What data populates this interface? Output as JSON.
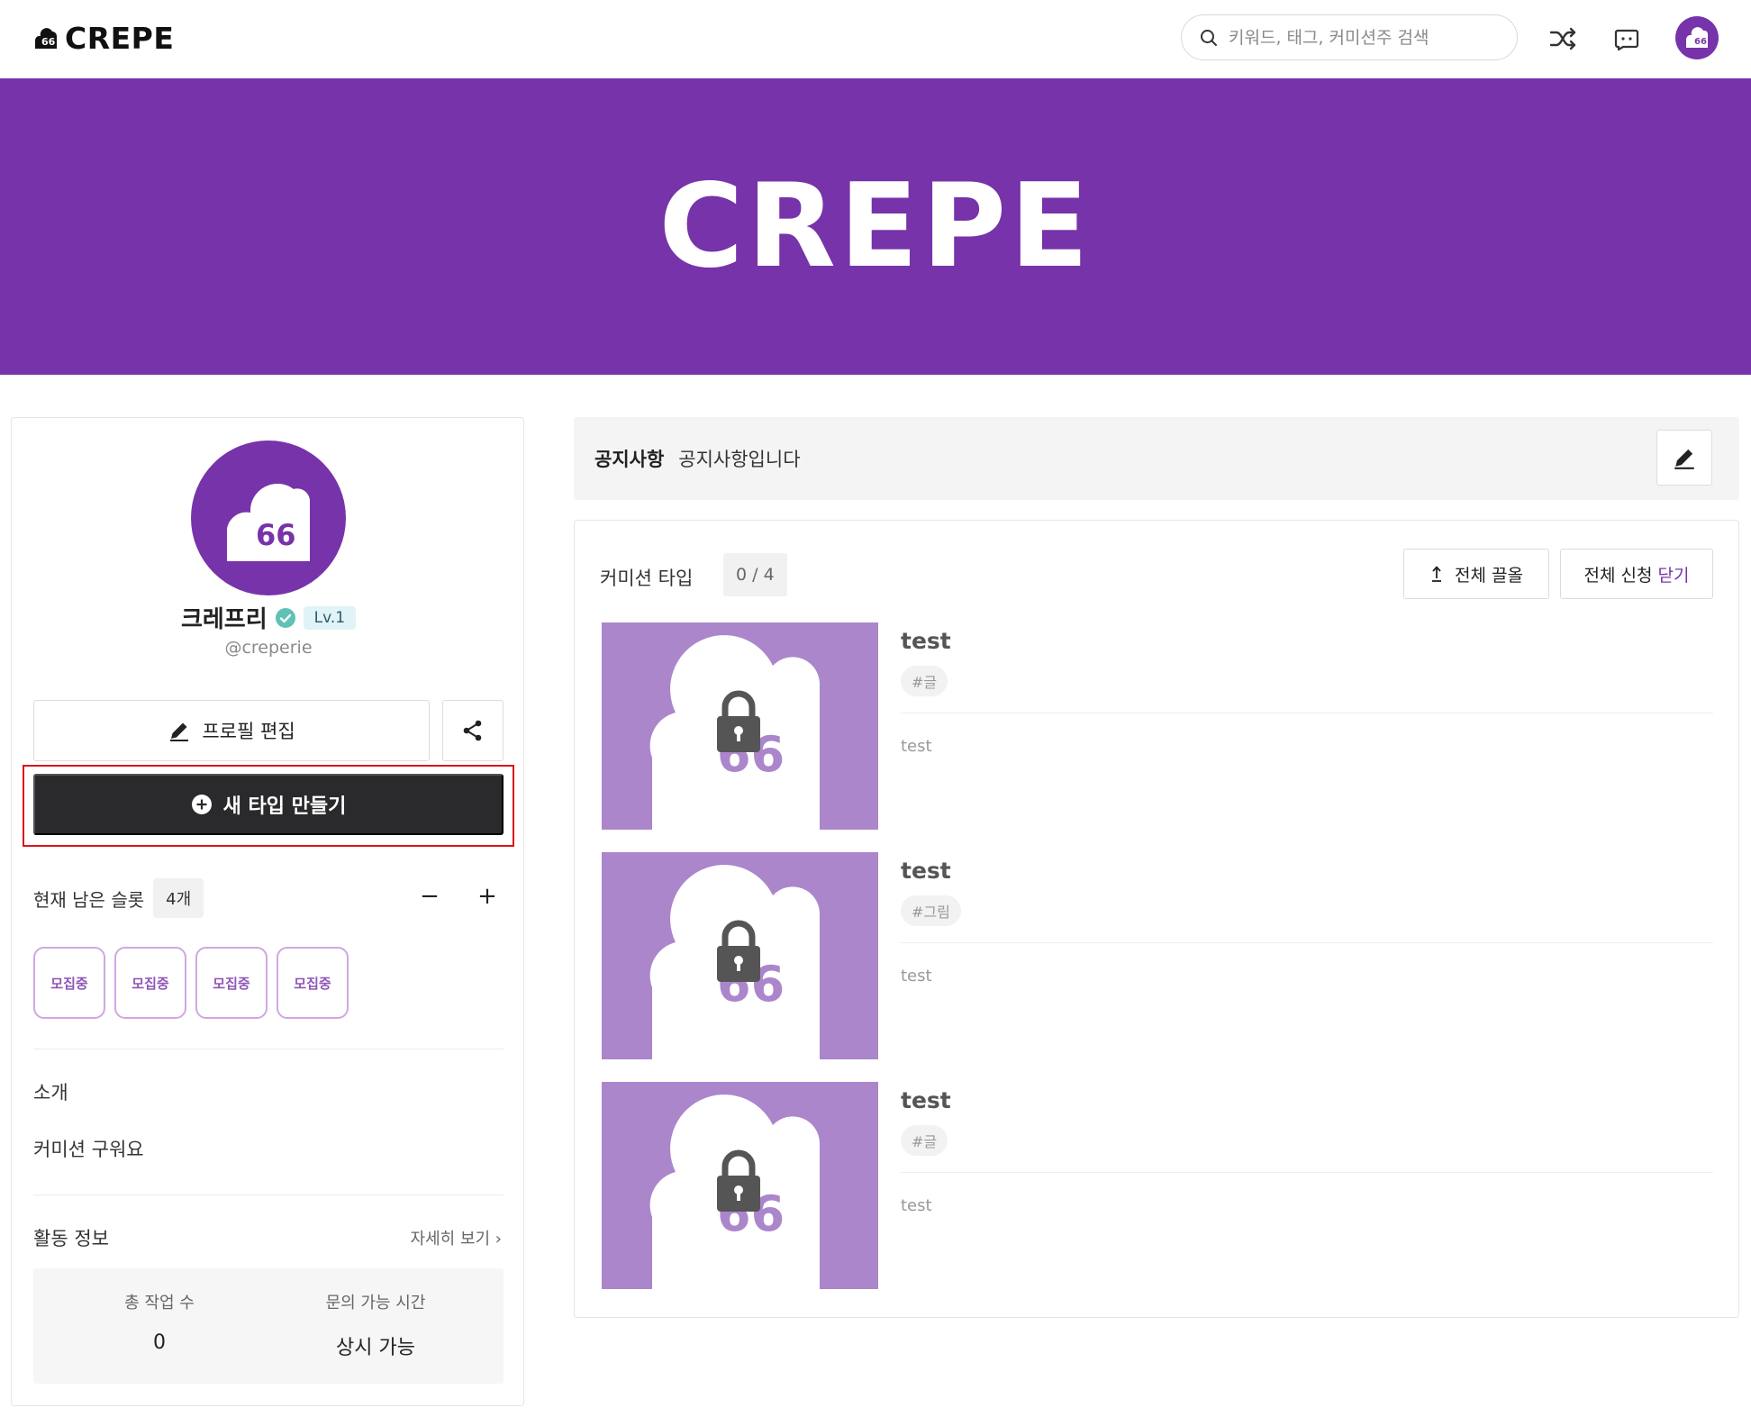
{
  "header": {
    "logo_text": "CREPE",
    "search_placeholder": "키워드, 태그, 커미션주 검색"
  },
  "banner": {
    "title": "CREPE"
  },
  "profile": {
    "name": "크레프리",
    "level": "Lv.1",
    "handle": "@creperie",
    "edit_button": "프로필 편집",
    "new_type_button": "새 타입 만들기",
    "slots_label": "현재 남은 슬롯",
    "slots_count": "4개",
    "minus": "−",
    "plus": "+",
    "slot_chips": [
      "모집중",
      "모집중",
      "모집중",
      "모집중"
    ],
    "intro_label": "소개",
    "intro_text": "커미션 구워요",
    "activity_label": "활동 정보",
    "more_link": "자세히 보기 ›",
    "stats": [
      {
        "label": "총 작업 수",
        "value": "0"
      },
      {
        "label": "문의 가능 시간",
        "value": "상시 가능"
      }
    ]
  },
  "notice": {
    "label": "공지사항",
    "text": "공지사항입니다"
  },
  "commission_types": {
    "title": "커미션 타입",
    "count": "0 / 4",
    "pull_all_button": "전체 끌올",
    "close_all_prefix": "전체 신청",
    "close_all_accent": "닫기",
    "items": [
      {
        "name": "test",
        "tag": "#글",
        "description": "test"
      },
      {
        "name": "test",
        "tag": "#그림",
        "description": "test"
      },
      {
        "name": "test",
        "tag": "#글",
        "description": "test"
      }
    ]
  },
  "colors": {
    "brand_purple": "#7733aa",
    "thumb_purple": "#ab86cb",
    "dark_button": "#2a2a2c",
    "highlight_red": "#d9141a"
  },
  "icons": [
    "logo-icon",
    "search-icon",
    "shuffle-icon",
    "chat-icon",
    "avatar",
    "verified-icon",
    "pencil-icon",
    "share-icon",
    "plus-circle-icon",
    "pull-up-icon",
    "lock-icon"
  ]
}
